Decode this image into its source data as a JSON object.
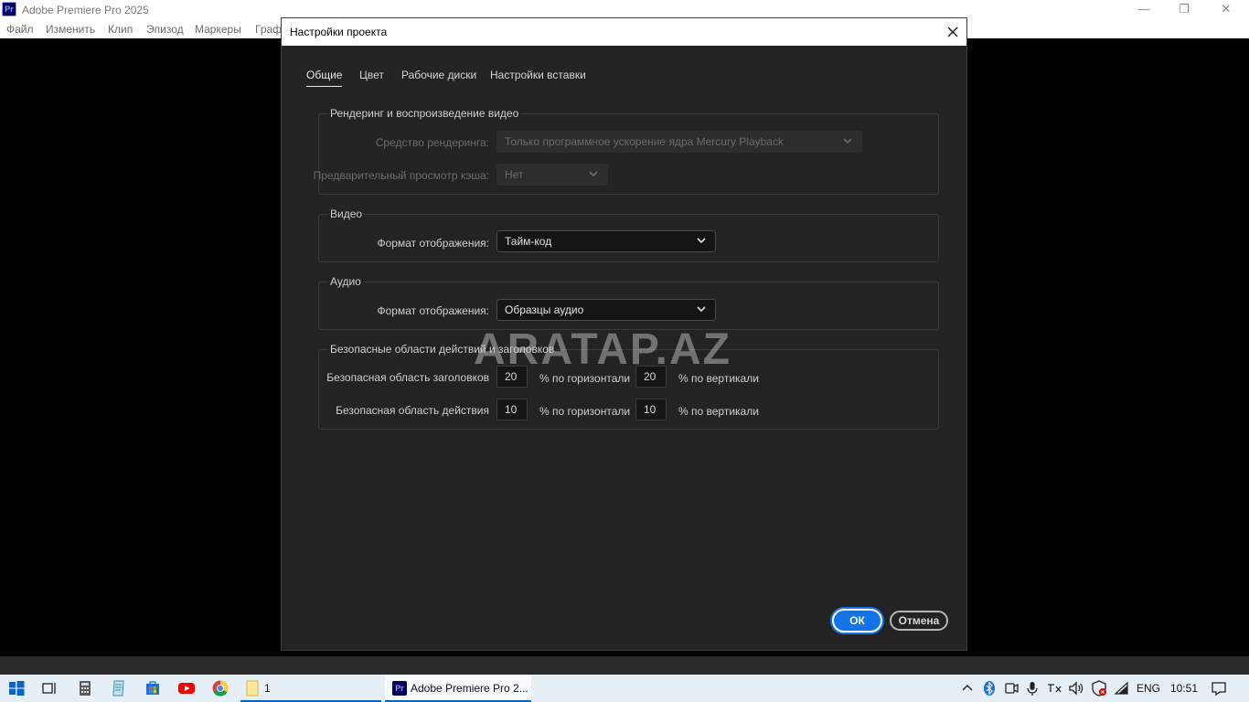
{
  "app": {
    "logo": "Pr",
    "title": "Adobe Premiere Pro 2025",
    "menu": [
      "Файл",
      "Изменить",
      "Клип",
      "Эпизод",
      "Маркеры",
      "Граф"
    ]
  },
  "dialog": {
    "title": "Настройки проекта",
    "tabs": [
      "Общие",
      "Цвет",
      "Рабочие диски",
      "Настройки вставки"
    ],
    "active_tab": "Общие",
    "rendering": {
      "title": "Рендеринг и воспроизведение видео",
      "renderer_label": "Средство рендеринга:",
      "renderer_value": "Только программное ускорение ядра Mercury Playback",
      "cache_label": "Предварительный просмотр кэша:",
      "cache_value": "Нет"
    },
    "video": {
      "title": "Видео",
      "format_label": "Формат отображения:",
      "format_value": "Тайм-код"
    },
    "audio": {
      "title": "Аудио",
      "format_label": "Формат отображения:",
      "format_value": "Образцы аудио"
    },
    "safe": {
      "title": "Безопасные области действий и заголовков",
      "title_safe_label": "Безопасная область заголовков",
      "title_h": "20",
      "title_v": "20",
      "action_safe_label": "Безопасная область действия",
      "action_h": "10",
      "action_v": "10",
      "h_suffix": "% по горизонтали",
      "v_suffix": "% по вертикали"
    },
    "ok": "ОК",
    "cancel": "Отмена"
  },
  "watermark": "ARATAP.AZ",
  "taskbar": {
    "folder_label": "1",
    "app_label": "Adobe Premiere Pro 2...",
    "lang": "ENG",
    "time": "10:51"
  },
  "colors": {
    "accent": "#1473e6",
    "dialog_bg": "#232323",
    "premiere_brand": "#00005b"
  }
}
